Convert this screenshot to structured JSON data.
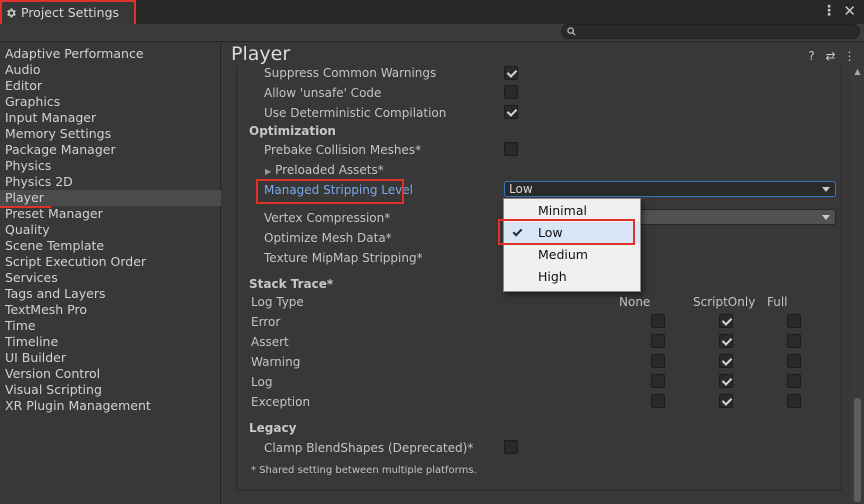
{
  "window": {
    "tab_title": "Project Settings",
    "menu_glyph": "⋮",
    "close_glyph": "✕"
  },
  "search": {
    "value": "",
    "placeholder": ""
  },
  "sidebar": {
    "items": [
      {
        "label": "Adaptive Performance"
      },
      {
        "label": "Audio"
      },
      {
        "label": "Editor"
      },
      {
        "label": "Graphics"
      },
      {
        "label": "Input Manager"
      },
      {
        "label": "Memory Settings"
      },
      {
        "label": "Package Manager"
      },
      {
        "label": "Physics"
      },
      {
        "label": "Physics 2D"
      },
      {
        "label": "Player",
        "active": true
      },
      {
        "label": "Preset Manager"
      },
      {
        "label": "Quality"
      },
      {
        "label": "Scene Template"
      },
      {
        "label": "Script Execution Order"
      },
      {
        "label": "Services"
      },
      {
        "label": "Tags and Layers"
      },
      {
        "label": "TextMesh Pro"
      },
      {
        "label": "Time"
      },
      {
        "label": "Timeline"
      },
      {
        "label": "UI Builder"
      },
      {
        "label": "Version Control"
      },
      {
        "label": "Visual Scripting"
      },
      {
        "label": "XR Plugin Management"
      }
    ]
  },
  "panel": {
    "title": "Player",
    "help_glyph": "?",
    "presets_glyph": "⇄",
    "more_glyph": "⋮"
  },
  "settings": {
    "suppress_warnings": {
      "label": "Suppress Common Warnings",
      "checked": true
    },
    "allow_unsafe": {
      "label": "Allow 'unsafe' Code",
      "checked": false
    },
    "deterministic": {
      "label": "Use Deterministic Compilation",
      "checked": true
    },
    "optimization_header": "Optimization",
    "prebake": {
      "label": "Prebake Collision Meshes*",
      "checked": false
    },
    "preloaded": {
      "label": "Preloaded Assets*",
      "arrow": "▶"
    },
    "stripping": {
      "label": "Managed Stripping Level",
      "value": "Low"
    },
    "vertex": {
      "label": "Vertex Compression*"
    },
    "optimize_mesh": {
      "label": "Optimize Mesh Data*"
    },
    "mipmap": {
      "label": "Texture MipMap Stripping*"
    }
  },
  "dropdown": {
    "options": [
      {
        "label": "Minimal",
        "selected": false
      },
      {
        "label": "Low",
        "selected": true
      },
      {
        "label": "Medium",
        "selected": false
      },
      {
        "label": "High",
        "selected": false
      }
    ]
  },
  "stack_trace": {
    "header": "Stack Trace*",
    "log_type_label": "Log Type",
    "columns": [
      "None",
      "ScriptOnly",
      "Full"
    ],
    "rows": [
      {
        "label": "Error",
        "values": [
          false,
          true,
          false
        ]
      },
      {
        "label": "Assert",
        "values": [
          false,
          true,
          false
        ]
      },
      {
        "label": "Warning",
        "values": [
          false,
          true,
          false
        ]
      },
      {
        "label": "Log",
        "values": [
          false,
          true,
          false
        ]
      },
      {
        "label": "Exception",
        "values": [
          false,
          true,
          false
        ]
      }
    ]
  },
  "legacy": {
    "header": "Legacy",
    "clamp": {
      "label": "Clamp BlendShapes (Deprecated)*",
      "checked": false
    }
  },
  "footnote": "* Shared setting between multiple platforms.",
  "colors": {
    "highlight": "#e0302a",
    "link": "#7aa7e8",
    "selection": "#d9e6f5"
  }
}
